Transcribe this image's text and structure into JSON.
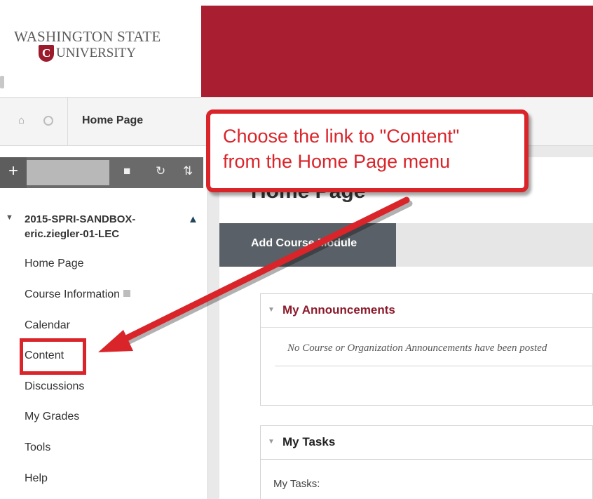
{
  "header": {
    "logo_line1": "WASHINGTON STATE",
    "logo_line2": "UNIVERSITY",
    "logo_mark": "C",
    "brand_color": "#a91e31"
  },
  "breadcrumb": {
    "home_icon": "home-icon",
    "current": "Home Page"
  },
  "sidebar": {
    "add_symbol": "+",
    "tool_icons": [
      "folder-icon",
      "refresh-icon",
      "sort-icon"
    ],
    "course_title": "2015-SPRI-SANDBOX-eric.ziegler-01-LEC",
    "items": [
      {
        "label": "Home Page"
      },
      {
        "label": "Course Information"
      },
      {
        "label": "Calendar"
      },
      {
        "label": "Content"
      },
      {
        "label": "Discussions"
      },
      {
        "label": "My Grades"
      },
      {
        "label": "Tools"
      },
      {
        "label": "Help"
      }
    ]
  },
  "main": {
    "page_title": "Home Page",
    "add_module_button": "Add Course Module",
    "announcements": {
      "title": "My Announcements",
      "empty_text": "No Course or Organization Announcements have been posted"
    },
    "tasks": {
      "title": "My Tasks",
      "body": "My Tasks:"
    }
  },
  "callout": {
    "line1": "Choose the link to \"Content\"",
    "line2": "from the Home Page menu",
    "color": "#d9242a"
  }
}
